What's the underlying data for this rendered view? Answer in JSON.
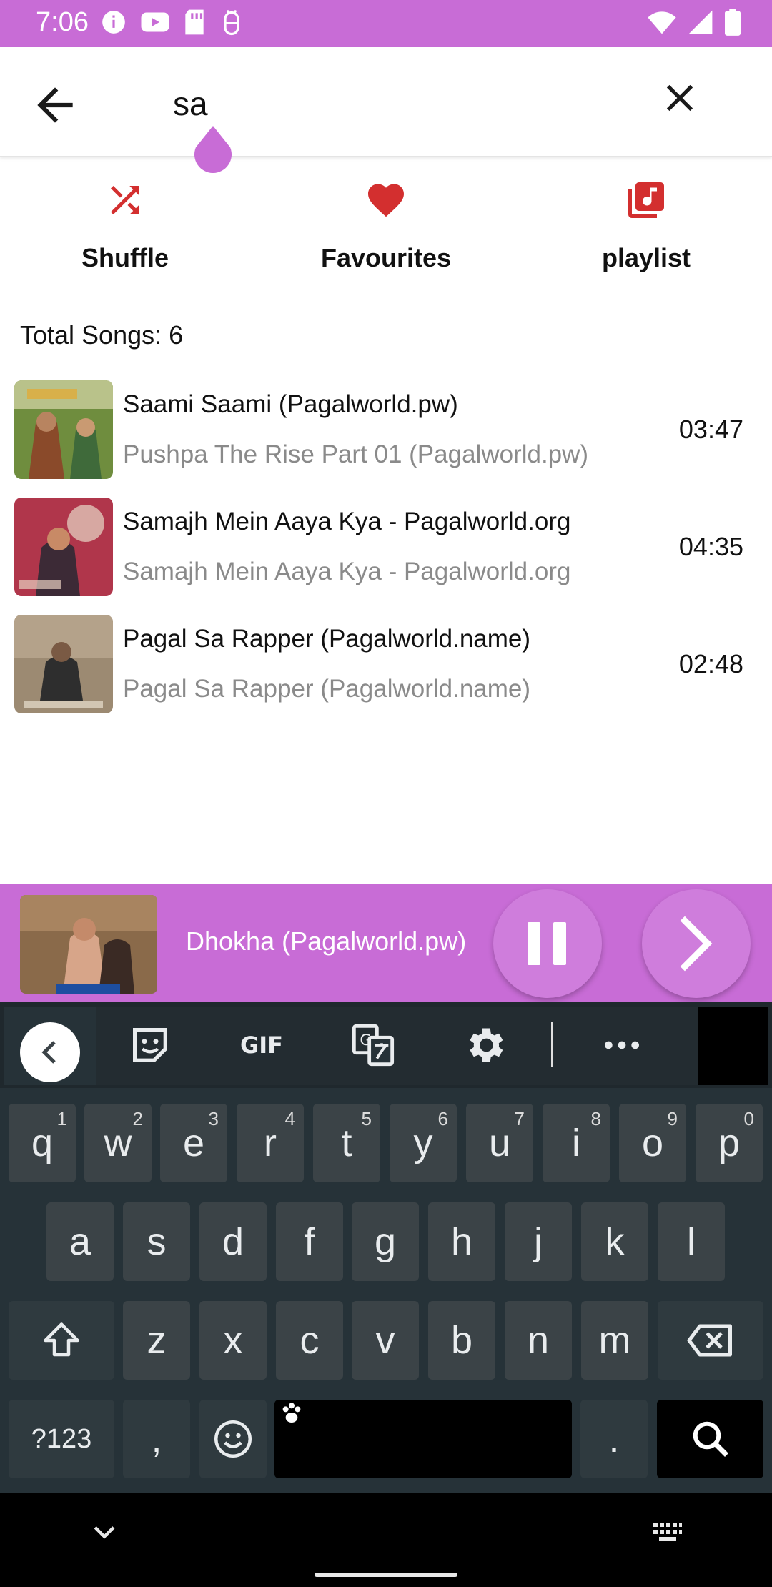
{
  "status_bar": {
    "time": "7:06",
    "bg_color": "#c86cd6",
    "left_icons": [
      "info-icon",
      "youtube-icon",
      "sd-card-icon",
      "android-debug-icon"
    ],
    "right_icons": [
      "wifi-icon",
      "signal-icon",
      "battery-icon"
    ]
  },
  "search": {
    "value": "sa",
    "back_icon": "arrow-left-icon",
    "clear_icon": "close-icon"
  },
  "actions": [
    {
      "label": "Shuffle",
      "icon": "shuffle-icon",
      "color": "#d32f2f"
    },
    {
      "label": "Favourites",
      "icon": "heart-icon",
      "color": "#d32f2f"
    },
    {
      "label": "playlist",
      "icon": "playlist-icon",
      "color": "#d32f2f"
    }
  ],
  "total_songs": "Total Songs: 6",
  "songs": [
    {
      "title": "Saami Saami (Pagalworld.pw)",
      "album": "Pushpa The Rise Part 01 (Pagalworld.pw)",
      "duration": "03:47"
    },
    {
      "title": "Samajh Mein Aaya Kya - Pagalworld.org",
      "album": "Samajh Mein Aaya Kya - Pagalworld.org",
      "duration": "04:35"
    },
    {
      "title": "Pagal Sa Rapper (Pagalworld.name)",
      "album": "Pagal Sa Rapper (Pagalworld.name)",
      "duration": "02:48"
    }
  ],
  "now_playing": {
    "title": "Dhokha (Pagalworld.pw)",
    "pause_icon": "pause-icon",
    "next_icon": "chevron-right-icon",
    "accent": "#c86cd6"
  },
  "keyboard": {
    "toolbar": [
      "chevron-left-icon",
      "sticker-icon",
      "gif-icon",
      "translate-icon",
      "settings-icon",
      "more-icon"
    ],
    "gif_label": "GIF",
    "row1": [
      {
        "key": "q",
        "hint": "1"
      },
      {
        "key": "w",
        "hint": "2"
      },
      {
        "key": "e",
        "hint": "3"
      },
      {
        "key": "r",
        "hint": "4"
      },
      {
        "key": "t",
        "hint": "5"
      },
      {
        "key": "y",
        "hint": "6"
      },
      {
        "key": "u",
        "hint": "7"
      },
      {
        "key": "i",
        "hint": "8"
      },
      {
        "key": "o",
        "hint": "9"
      },
      {
        "key": "p",
        "hint": "0"
      }
    ],
    "row2": [
      "a",
      "s",
      "d",
      "f",
      "g",
      "h",
      "j",
      "k",
      "l"
    ],
    "row3": [
      "z",
      "x",
      "c",
      "v",
      "b",
      "n",
      "m"
    ],
    "symbols_label": "?123",
    "comma": ",",
    "period": "."
  },
  "nav_bar": {
    "icons": [
      "chevron-down-icon",
      "keyboard-icon"
    ]
  }
}
